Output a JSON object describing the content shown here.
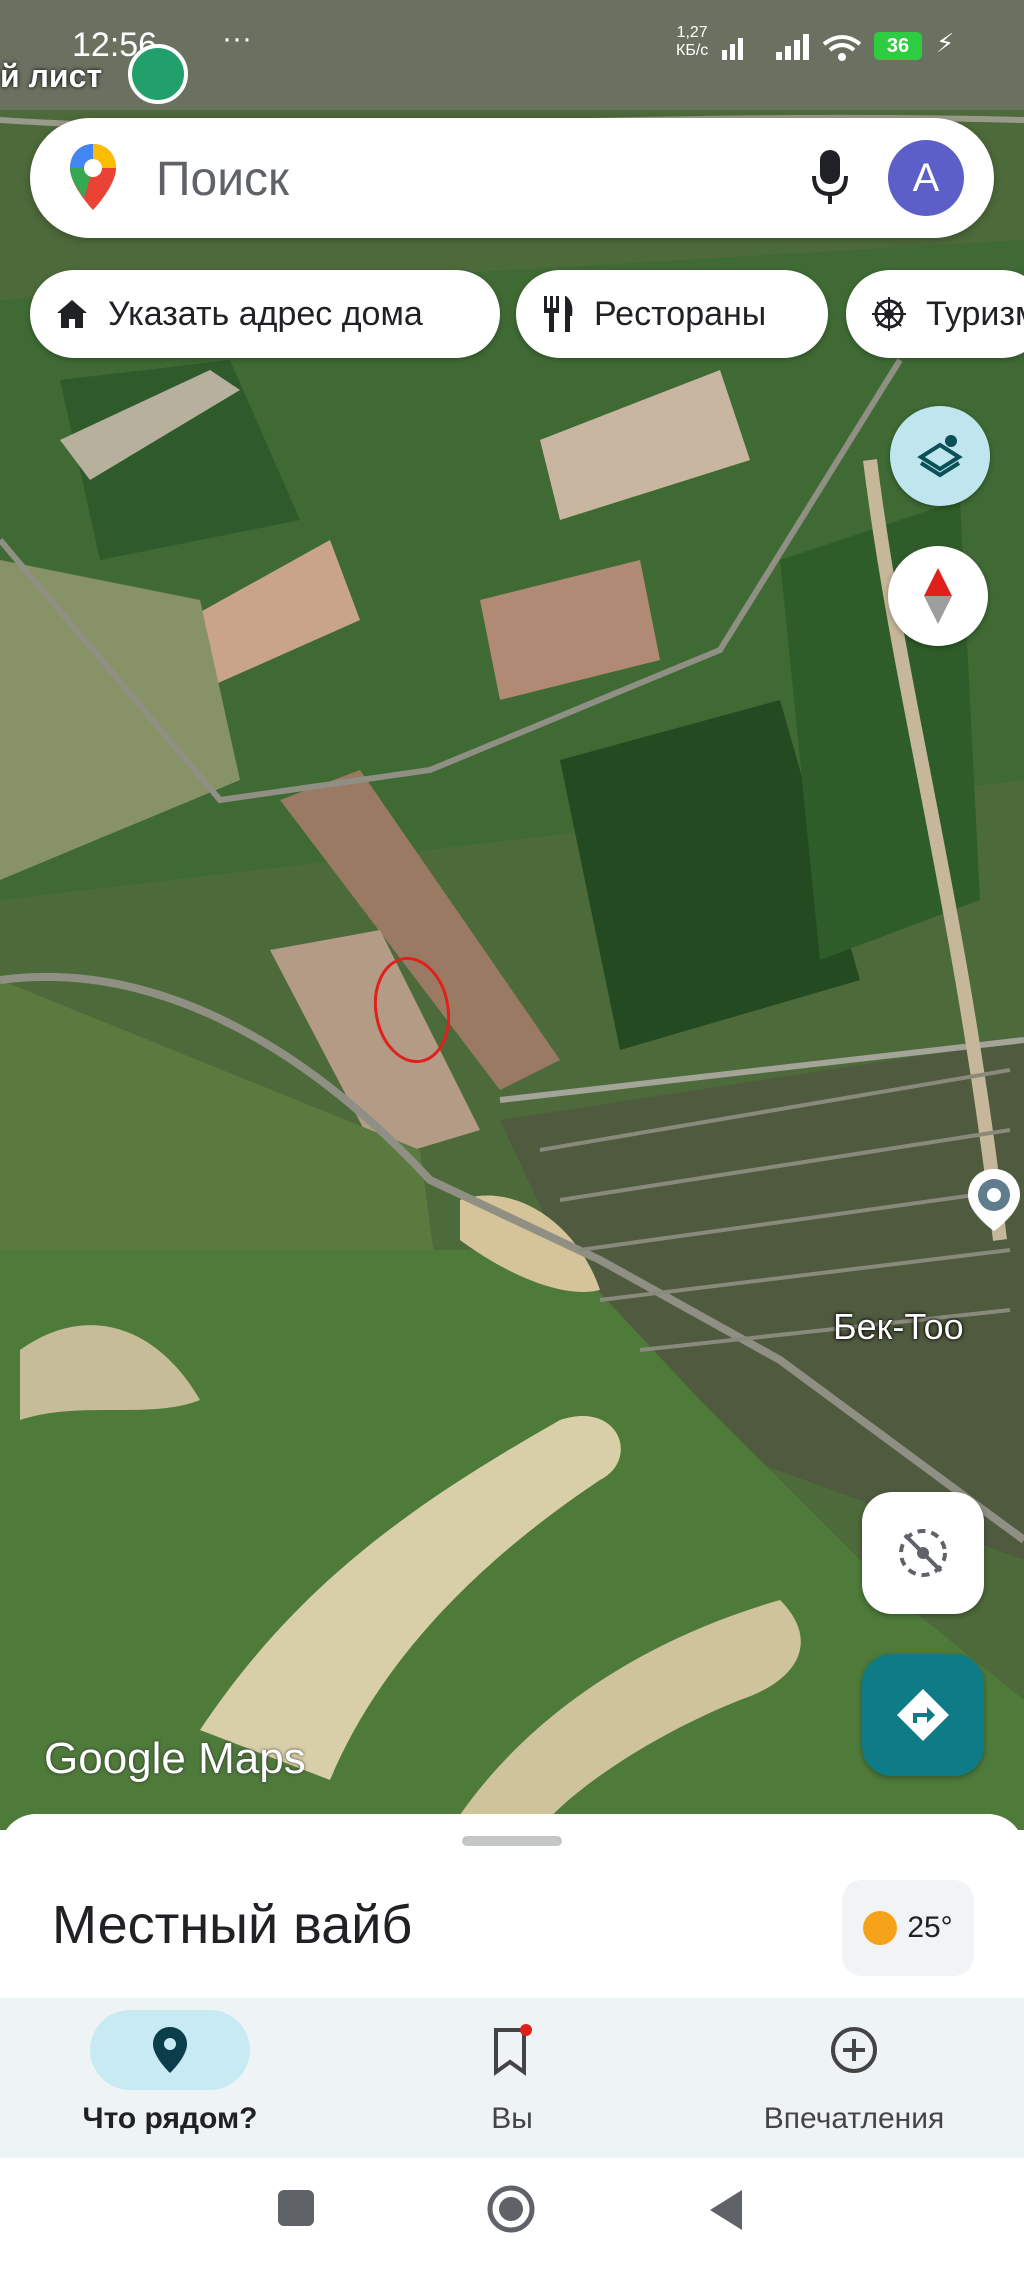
{
  "status_bar": {
    "time": "12:56",
    "dots": "···",
    "net_speed": "1,27",
    "net_unit": "КБ/с",
    "battery": "36"
  },
  "app_overlay_label": "й лист",
  "search": {
    "placeholder": "Поиск",
    "avatar_letter": "A"
  },
  "chips": [
    {
      "label": "Указать адрес дома",
      "icon": "home-icon"
    },
    {
      "label": "Рестораны",
      "icon": "restaurant-icon"
    },
    {
      "label": "Туризм",
      "icon": "attraction-icon"
    }
  ],
  "map": {
    "place_label": "Бек-Тоо",
    "watermark": "Google Maps",
    "buttons": [
      "layers-icon",
      "compass-icon",
      "location-pin-icon",
      "my-location-icon",
      "directions-icon"
    ]
  },
  "sheet": {
    "title": "Местный вайб",
    "temperature": "25°"
  },
  "bottom_nav": [
    {
      "label": "Что рядом?",
      "icon": "place-icon",
      "active": true
    },
    {
      "label": "Вы",
      "icon": "bookmark-icon",
      "active": false,
      "badge": true
    },
    {
      "label": "Впечатления",
      "icon": "add-circle-icon",
      "active": false
    }
  ],
  "colors": {
    "accent_teal": "#0e7c86",
    "avatar": "#5b5fc7",
    "active_pill": "#c8eaf3",
    "annotation_red": "#e0201b"
  }
}
